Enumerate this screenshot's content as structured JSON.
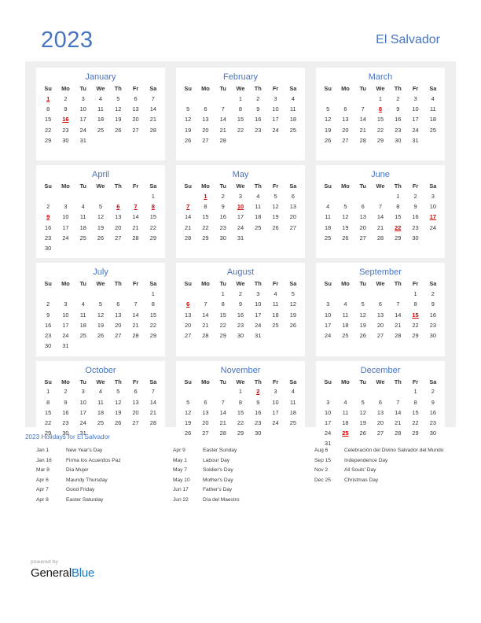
{
  "header": {
    "year": "2023",
    "country": "El Salvador"
  },
  "months": [
    {
      "name": "January",
      "weekdays": [
        "Su",
        "Mo",
        "Tu",
        "We",
        "Th",
        "Fr",
        "Sa"
      ],
      "weeks": [
        [
          "1",
          "2",
          "3",
          "4",
          "5",
          "6",
          "7"
        ],
        [
          "8",
          "9",
          "10",
          "11",
          "12",
          "13",
          "14"
        ],
        [
          "15",
          "16",
          "17",
          "18",
          "19",
          "20",
          "21"
        ],
        [
          "22",
          "23",
          "24",
          "25",
          "26",
          "27",
          "28"
        ],
        [
          "29",
          "30",
          "31",
          "",
          "",
          "",
          ""
        ],
        [
          "",
          "",
          "",
          "",
          "",
          "",
          ""
        ]
      ],
      "holidays": [
        "1",
        "16"
      ]
    },
    {
      "name": "February",
      "weekdays": [
        "Su",
        "Mo",
        "Tu",
        "We",
        "Th",
        "Fr",
        "Sa"
      ],
      "weeks": [
        [
          "",
          "",
          "",
          "1",
          "2",
          "3",
          "4"
        ],
        [
          "5",
          "6",
          "7",
          "8",
          "9",
          "10",
          "11"
        ],
        [
          "12",
          "13",
          "14",
          "15",
          "16",
          "17",
          "18"
        ],
        [
          "19",
          "20",
          "21",
          "22",
          "23",
          "24",
          "25"
        ],
        [
          "26",
          "27",
          "28",
          "",
          "",
          "",
          ""
        ],
        [
          "",
          "",
          "",
          "",
          "",
          "",
          ""
        ]
      ],
      "holidays": []
    },
    {
      "name": "March",
      "weekdays": [
        "Su",
        "Mo",
        "Tu",
        "We",
        "Th",
        "Fr",
        "Sa"
      ],
      "weeks": [
        [
          "",
          "",
          "",
          "1",
          "2",
          "3",
          "4"
        ],
        [
          "5",
          "6",
          "7",
          "8",
          "9",
          "10",
          "11"
        ],
        [
          "12",
          "13",
          "14",
          "15",
          "16",
          "17",
          "18"
        ],
        [
          "19",
          "20",
          "21",
          "22",
          "23",
          "24",
          "25"
        ],
        [
          "26",
          "27",
          "28",
          "29",
          "30",
          "31",
          ""
        ],
        [
          "",
          "",
          "",
          "",
          "",
          "",
          ""
        ]
      ],
      "holidays": [
        "8"
      ]
    },
    {
      "name": "April",
      "weekdays": [
        "Su",
        "Mo",
        "Tu",
        "We",
        "Th",
        "Fr",
        "Sa"
      ],
      "weeks": [
        [
          "",
          "",
          "",
          "",
          "",
          "",
          "1"
        ],
        [
          "2",
          "3",
          "4",
          "5",
          "6",
          "7",
          "8"
        ],
        [
          "9",
          "10",
          "11",
          "12",
          "13",
          "14",
          "15"
        ],
        [
          "16",
          "17",
          "18",
          "19",
          "20",
          "21",
          "22"
        ],
        [
          "23",
          "24",
          "25",
          "26",
          "27",
          "28",
          "29"
        ],
        [
          "30",
          "",
          "",
          "",
          "",
          "",
          ""
        ]
      ],
      "holidays": [
        "6",
        "7",
        "8",
        "9"
      ]
    },
    {
      "name": "May",
      "weekdays": [
        "Su",
        "Mo",
        "Tu",
        "We",
        "Th",
        "Fr",
        "Sa"
      ],
      "weeks": [
        [
          "",
          "1",
          "2",
          "3",
          "4",
          "5",
          "6"
        ],
        [
          "7",
          "8",
          "9",
          "10",
          "11",
          "12",
          "13"
        ],
        [
          "14",
          "15",
          "16",
          "17",
          "18",
          "19",
          "20"
        ],
        [
          "21",
          "22",
          "23",
          "24",
          "25",
          "26",
          "27"
        ],
        [
          "28",
          "29",
          "30",
          "31",
          "",
          "",
          ""
        ],
        [
          "",
          "",
          "",
          "",
          "",
          "",
          ""
        ]
      ],
      "holidays": [
        "1",
        "7",
        "10"
      ]
    },
    {
      "name": "June",
      "weekdays": [
        "Su",
        "Mo",
        "Tu",
        "We",
        "Th",
        "Fr",
        "Sa"
      ],
      "weeks": [
        [
          "",
          "",
          "",
          "",
          "1",
          "2",
          "3"
        ],
        [
          "4",
          "5",
          "6",
          "7",
          "8",
          "9",
          "10"
        ],
        [
          "11",
          "12",
          "13",
          "14",
          "15",
          "16",
          "17"
        ],
        [
          "18",
          "19",
          "20",
          "21",
          "22",
          "23",
          "24"
        ],
        [
          "25",
          "26",
          "27",
          "28",
          "29",
          "30",
          ""
        ],
        [
          "",
          "",
          "",
          "",
          "",
          "",
          ""
        ]
      ],
      "holidays": [
        "17",
        "22"
      ]
    },
    {
      "name": "July",
      "weekdays": [
        "Su",
        "Mo",
        "Tu",
        "We",
        "Th",
        "Fr",
        "Sa"
      ],
      "weeks": [
        [
          "",
          "",
          "",
          "",
          "",
          "",
          "1"
        ],
        [
          "2",
          "3",
          "4",
          "5",
          "6",
          "7",
          "8"
        ],
        [
          "9",
          "10",
          "11",
          "12",
          "13",
          "14",
          "15"
        ],
        [
          "16",
          "17",
          "18",
          "19",
          "20",
          "21",
          "22"
        ],
        [
          "23",
          "24",
          "25",
          "26",
          "27",
          "28",
          "29"
        ],
        [
          "30",
          "31",
          "",
          "",
          "",
          "",
          ""
        ]
      ],
      "holidays": []
    },
    {
      "name": "August",
      "weekdays": [
        "Su",
        "Mo",
        "Tu",
        "We",
        "Th",
        "Fr",
        "Sa"
      ],
      "weeks": [
        [
          "",
          "",
          "1",
          "2",
          "3",
          "4",
          "5"
        ],
        [
          "6",
          "7",
          "8",
          "9",
          "10",
          "11",
          "12"
        ],
        [
          "13",
          "14",
          "15",
          "16",
          "17",
          "18",
          "19"
        ],
        [
          "20",
          "21",
          "22",
          "23",
          "24",
          "25",
          "26"
        ],
        [
          "27",
          "28",
          "29",
          "30",
          "31",
          "",
          ""
        ],
        [
          "",
          "",
          "",
          "",
          "",
          "",
          ""
        ]
      ],
      "holidays": [
        "6"
      ]
    },
    {
      "name": "September",
      "weekdays": [
        "Su",
        "Mo",
        "Tu",
        "We",
        "Th",
        "Fr",
        "Sa"
      ],
      "weeks": [
        [
          "",
          "",
          "",
          "",
          "",
          "1",
          "2"
        ],
        [
          "3",
          "4",
          "5",
          "6",
          "7",
          "8",
          "9"
        ],
        [
          "10",
          "11",
          "12",
          "13",
          "14",
          "15",
          "16"
        ],
        [
          "17",
          "18",
          "19",
          "20",
          "21",
          "22",
          "23"
        ],
        [
          "24",
          "25",
          "26",
          "27",
          "28",
          "29",
          "30"
        ],
        [
          "",
          "",
          "",
          "",
          "",
          "",
          ""
        ]
      ],
      "holidays": [
        "15"
      ]
    },
    {
      "name": "October",
      "weekdays": [
        "Su",
        "Mo",
        "Tu",
        "We",
        "Th",
        "Fr",
        "Sa"
      ],
      "weeks": [
        [
          "1",
          "2",
          "3",
          "4",
          "5",
          "6",
          "7"
        ],
        [
          "8",
          "9",
          "10",
          "11",
          "12",
          "13",
          "14"
        ],
        [
          "15",
          "16",
          "17",
          "18",
          "19",
          "20",
          "21"
        ],
        [
          "22",
          "23",
          "24",
          "25",
          "26",
          "27",
          "28"
        ],
        [
          "29",
          "30",
          "31",
          "",
          "",
          "",
          ""
        ],
        [
          "",
          "",
          "",
          "",
          "",
          "",
          ""
        ]
      ],
      "holidays": []
    },
    {
      "name": "November",
      "weekdays": [
        "Su",
        "Mo",
        "Tu",
        "We",
        "Th",
        "Fr",
        "Sa"
      ],
      "weeks": [
        [
          "",
          "",
          "",
          "1",
          "2",
          "3",
          "4"
        ],
        [
          "5",
          "6",
          "7",
          "8",
          "9",
          "10",
          "11"
        ],
        [
          "12",
          "13",
          "14",
          "15",
          "16",
          "17",
          "18"
        ],
        [
          "19",
          "20",
          "21",
          "22",
          "23",
          "24",
          "25"
        ],
        [
          "26",
          "27",
          "28",
          "29",
          "30",
          "",
          ""
        ],
        [
          "",
          "",
          "",
          "",
          "",
          "",
          ""
        ]
      ],
      "holidays": [
        "2"
      ]
    },
    {
      "name": "December",
      "weekdays": [
        "Su",
        "Mo",
        "Tu",
        "We",
        "Th",
        "Fr",
        "Sa"
      ],
      "weeks": [
        [
          "",
          "",
          "",
          "",
          "",
          "1",
          "2"
        ],
        [
          "3",
          "4",
          "5",
          "6",
          "7",
          "8",
          "9"
        ],
        [
          "10",
          "11",
          "12",
          "13",
          "14",
          "15",
          "16"
        ],
        [
          "17",
          "18",
          "19",
          "20",
          "21",
          "22",
          "23"
        ],
        [
          "24",
          "25",
          "26",
          "27",
          "28",
          "29",
          "30"
        ],
        [
          "31",
          "",
          "",
          "",
          "",
          "",
          ""
        ]
      ],
      "holidays": [
        "25"
      ]
    }
  ],
  "holidays_section": {
    "heading": "2023 Holidays for El Salvador",
    "columns": [
      [
        {
          "date": "Jan 1",
          "name": "New Year's Day"
        },
        {
          "date": "Jan 16",
          "name": "Firma  los Acuerdos  Paz"
        },
        {
          "date": "Mar 8",
          "name": "Día   Mujer"
        },
        {
          "date": "Apr 6",
          "name": "Maundy Thursday"
        },
        {
          "date": "Apr 7",
          "name": "Good Friday"
        },
        {
          "date": "Apr 8",
          "name": "Easter Saturday"
        }
      ],
      [
        {
          "date": "Apr 9",
          "name": "Easter Sunday"
        },
        {
          "date": "May 1",
          "name": "Labour Day"
        },
        {
          "date": "May 7",
          "name": "Soldier's Day"
        },
        {
          "date": "May 10",
          "name": "Mother's Day"
        },
        {
          "date": "Jun 17",
          "name": "Father's Day"
        },
        {
          "date": "Jun 22",
          "name": "Día del Maestro"
        }
      ],
      [
        {
          "date": "Aug 6",
          "name": "Celebración del Divino Salvador del Mundo"
        },
        {
          "date": "Sep 15",
          "name": "Independence Day"
        },
        {
          "date": "Nov 2",
          "name": "All Souls' Day"
        },
        {
          "date": "Dec 25",
          "name": "Christmas Day"
        }
      ]
    ]
  },
  "footer": {
    "powered_by": "powered by",
    "brand_first": "General",
    "brand_second": "Blue"
  },
  "colors": {
    "accent_blue": "#4674C1",
    "holiday_red": "#D40000",
    "panel_gray": "#EFEFEF",
    "brand_blue": "#1878C8"
  }
}
